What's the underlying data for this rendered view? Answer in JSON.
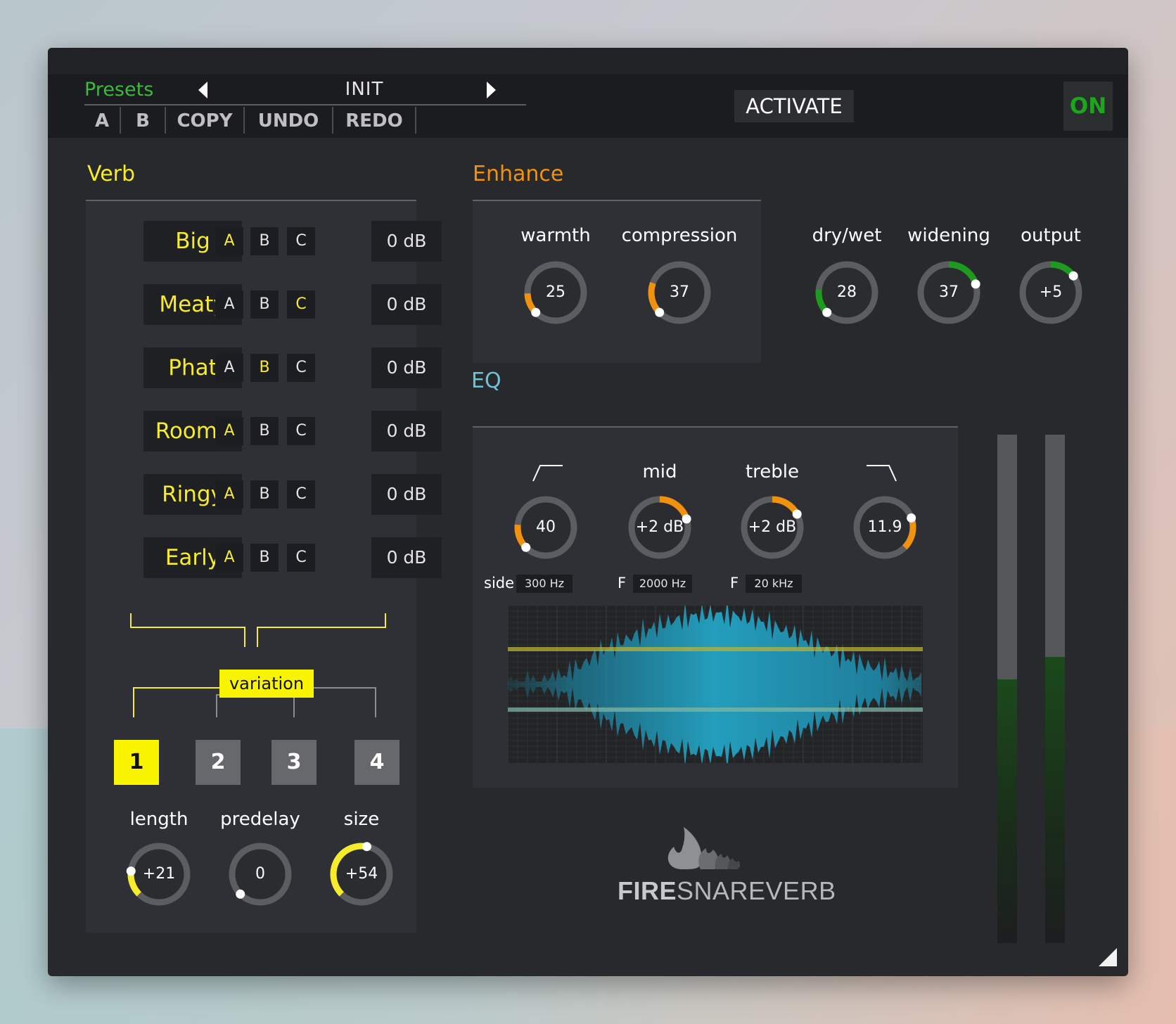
{
  "topbar": {
    "presets_label": "Presets",
    "preset_name": "INIT",
    "buttons": [
      "A",
      "B",
      "COPY",
      "UNDO",
      "REDO"
    ],
    "activate_label": "ACTIVATE",
    "power_label": "ON"
  },
  "verb": {
    "title": "Verb",
    "rows": [
      {
        "name": "Big",
        "selected": "A",
        "gain": "0 dB"
      },
      {
        "name": "Meaty",
        "selected": "C",
        "gain": "0 dB"
      },
      {
        "name": "Phat",
        "selected": "B",
        "gain": "0 dB"
      },
      {
        "name": "Roomy",
        "selected": "A",
        "gain": "0 dB"
      },
      {
        "name": "Ringy",
        "selected": "A",
        "gain": "0 dB"
      },
      {
        "name": "Early",
        "selected": "A",
        "gain": "0 dB"
      }
    ],
    "abc_labels": [
      "A",
      "B",
      "C"
    ],
    "variation_label": "variation",
    "variations": [
      "1",
      "2",
      "3",
      "4"
    ],
    "selected_variation": "1",
    "knobs": [
      {
        "label": "length",
        "value": "+21"
      },
      {
        "label": "predelay",
        "value": "0"
      },
      {
        "label": "size",
        "value": "+54"
      }
    ]
  },
  "enhance": {
    "title": "Enhance",
    "knobs": [
      {
        "label": "warmth",
        "value": "25"
      },
      {
        "label": "compression",
        "value": "37"
      }
    ],
    "output_knobs": [
      {
        "label": "dry/wet",
        "value": "28"
      },
      {
        "label": "widening",
        "value": "37"
      },
      {
        "label": "output",
        "value": "+5"
      }
    ]
  },
  "eq": {
    "title": "EQ",
    "knobs": [
      {
        "label": "",
        "icon": "highpass-icon",
        "value": "40"
      },
      {
        "label": "mid",
        "value": "+2 dB"
      },
      {
        "label": "treble",
        "value": "+2 dB"
      },
      {
        "label": "",
        "icon": "lowpass-icon",
        "value": "11.9"
      }
    ],
    "side_label": "side",
    "side_value": "300 Hz",
    "mid_f_label": "F",
    "mid_f_value": "2000 Hz",
    "treble_f_label": "F",
    "treble_f_value": "20 kHz"
  },
  "logo": {
    "text_bold": "FIRE",
    "text_light": "SNAREVERB"
  },
  "colors": {
    "verb_accent": "#f7ec2b",
    "enhance_accent": "#f0920f",
    "output_accent": "#1e9a1e",
    "eq_title": "#6fc3d6",
    "presets_green": "#3fb83f"
  }
}
